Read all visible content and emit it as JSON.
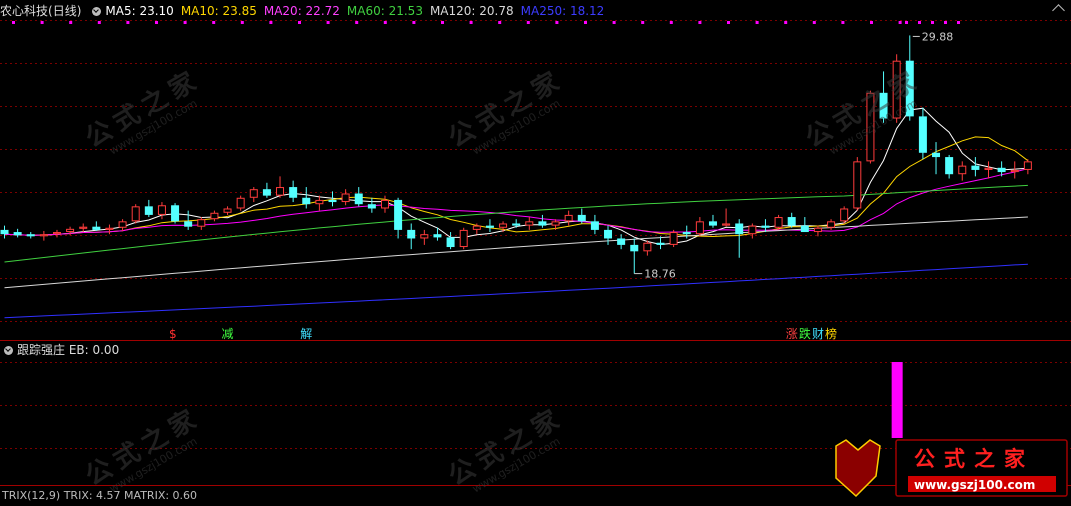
{
  "header": {
    "stock_name": "农心科技",
    "period": "(日线)",
    "ma": [
      {
        "label": "MA5: 23.10",
        "color": "#ffffff"
      },
      {
        "label": "MA10: 23.85",
        "color": "#ffd700"
      },
      {
        "label": "MA20: 22.72",
        "color": "#ff40ff"
      },
      {
        "label": "MA60: 21.53",
        "color": "#40d040"
      },
      {
        "label": "MA120: 20.78",
        "color": "#d8d8d8"
      },
      {
        "label": "MA250: 18.12",
        "color": "#3c3cff"
      }
    ]
  },
  "sub_panel": {
    "label": "跟踪强庄 EB: 0.00"
  },
  "bottom_panel": {
    "label": "TRIX(12,9)  TRIX: 4.57  MATRIX: 0.60"
  },
  "annotations": {
    "high": "29.88",
    "low": "18.76"
  },
  "signals": [
    {
      "text": "$",
      "color": "#ff3030",
      "candle": 13
    },
    {
      "text": "减",
      "color": "#40ff40",
      "candle": 17
    },
    {
      "text": "解",
      "color": "#40e0ff",
      "candle": 23
    },
    {
      "text": "涨",
      "color": "#ff4040",
      "candle": 60
    },
    {
      "text": "跌",
      "color": "#40ff40",
      "candle": 61
    },
    {
      "text": "财",
      "color": "#40e0ff",
      "candle": 62
    },
    {
      "text": "榜",
      "color": "#ffd700",
      "candle": 63
    }
  ],
  "watermarks": {
    "cn": "公式之家",
    "url": "www.gszj100.com"
  },
  "colors": {
    "up": "#ff3c3c",
    "down": "#54ffff",
    "grid": "#7a0000",
    "bg": "#000000",
    "magenta": "#ff00ff"
  },
  "chart_data": {
    "type": "candlestick",
    "ylim": [
      16.5,
      30.6
    ],
    "candles": [
      [
        20.8,
        21.0,
        20.4,
        20.6
      ],
      [
        20.7,
        20.85,
        20.45,
        20.55
      ],
      [
        20.6,
        20.7,
        20.4,
        20.5
      ],
      [
        20.5,
        20.75,
        20.3,
        20.6
      ],
      [
        20.6,
        20.8,
        20.45,
        20.7
      ],
      [
        20.7,
        20.95,
        20.55,
        20.85
      ],
      [
        20.85,
        21.1,
        20.7,
        20.95
      ],
      [
        20.95,
        21.2,
        20.75,
        20.8
      ],
      [
        20.8,
        21.05,
        20.6,
        20.9
      ],
      [
        20.9,
        21.3,
        20.75,
        21.2
      ],
      [
        21.2,
        22.0,
        21.1,
        21.9
      ],
      [
        21.9,
        22.2,
        21.4,
        21.5
      ],
      [
        21.5,
        22.1,
        21.3,
        21.95
      ],
      [
        21.95,
        22.05,
        21.1,
        21.2
      ],
      [
        21.2,
        21.7,
        20.8,
        20.95
      ],
      [
        20.95,
        21.4,
        20.8,
        21.3
      ],
      [
        21.3,
        21.7,
        21.2,
        21.6
      ],
      [
        21.6,
        21.9,
        21.5,
        21.8
      ],
      [
        21.8,
        22.4,
        21.7,
        22.3
      ],
      [
        22.3,
        22.8,
        22.1,
        22.7
      ],
      [
        22.7,
        23.0,
        22.3,
        22.4
      ],
      [
        22.4,
        23.3,
        22.3,
        22.8
      ],
      [
        22.8,
        23.1,
        22.1,
        22.3
      ],
      [
        22.3,
        22.8,
        21.8,
        22.0
      ],
      [
        22.0,
        22.4,
        21.7,
        22.2
      ],
      [
        22.2,
        22.6,
        21.9,
        22.1
      ],
      [
        22.1,
        22.7,
        21.95,
        22.5
      ],
      [
        22.5,
        22.8,
        21.9,
        22.0
      ],
      [
        22.0,
        22.3,
        21.6,
        21.8
      ],
      [
        21.8,
        22.4,
        21.6,
        22.2
      ],
      [
        22.2,
        22.3,
        20.4,
        20.8
      ],
      [
        20.8,
        21.1,
        19.9,
        20.4
      ],
      [
        20.4,
        20.8,
        20.1,
        20.6
      ],
      [
        20.6,
        20.9,
        20.3,
        20.45
      ],
      [
        20.45,
        20.7,
        19.9,
        20.0
      ],
      [
        20.0,
        20.9,
        19.9,
        20.8
      ],
      [
        20.8,
        21.1,
        20.6,
        21.0
      ],
      [
        21.0,
        21.3,
        20.7,
        20.9
      ],
      [
        20.9,
        21.2,
        20.7,
        21.1
      ],
      [
        21.1,
        21.3,
        20.9,
        21.0
      ],
      [
        21.0,
        21.4,
        20.8,
        21.2
      ],
      [
        21.2,
        21.5,
        20.9,
        21.0
      ],
      [
        21.0,
        21.3,
        20.8,
        21.2
      ],
      [
        21.2,
        21.7,
        21.0,
        21.5
      ],
      [
        21.5,
        21.8,
        21.1,
        21.2
      ],
      [
        21.2,
        21.5,
        20.6,
        20.8
      ],
      [
        20.8,
        21.0,
        20.1,
        20.4
      ],
      [
        20.4,
        20.6,
        19.9,
        20.1
      ],
      [
        20.1,
        20.4,
        18.76,
        19.8
      ],
      [
        19.8,
        20.3,
        19.6,
        20.2
      ],
      [
        20.2,
        20.5,
        19.9,
        20.1
      ],
      [
        20.1,
        20.8,
        20.0,
        20.7
      ],
      [
        20.7,
        21.0,
        20.4,
        20.6
      ],
      [
        20.6,
        21.4,
        20.5,
        21.2
      ],
      [
        21.2,
        21.5,
        20.9,
        21.0
      ],
      [
        21.0,
        21.8,
        20.95,
        21.1
      ],
      [
        21.1,
        21.3,
        19.5,
        20.6
      ],
      [
        20.6,
        21.1,
        20.4,
        21.0
      ],
      [
        21.0,
        21.3,
        20.7,
        20.9
      ],
      [
        20.9,
        21.5,
        20.8,
        21.4
      ],
      [
        21.4,
        21.6,
        20.9,
        21.0
      ],
      [
        21.0,
        21.4,
        20.8,
        20.7
      ],
      [
        20.7,
        21.0,
        20.5,
        20.9
      ],
      [
        20.9,
        21.3,
        20.8,
        21.2
      ],
      [
        21.2,
        21.9,
        21.1,
        21.8
      ],
      [
        21.8,
        24.2,
        21.7,
        24.0
      ],
      [
        24.0,
        27.3,
        23.9,
        27.2
      ],
      [
        27.2,
        28.2,
        25.8,
        26.0
      ],
      [
        26.0,
        29.0,
        25.8,
        28.7
      ],
      [
        28.7,
        29.88,
        25.9,
        26.1
      ],
      [
        26.1,
        26.5,
        24.1,
        24.4
      ],
      [
        24.4,
        24.9,
        23.4,
        24.2
      ],
      [
        24.2,
        24.3,
        23.2,
        23.4
      ],
      [
        23.4,
        24.0,
        23.1,
        23.8
      ],
      [
        23.8,
        24.2,
        23.3,
        23.6
      ],
      [
        23.6,
        24.0,
        23.2,
        23.7
      ],
      [
        23.7,
        24.0,
        23.3,
        23.5
      ],
      [
        23.5,
        24.0,
        23.2,
        23.6
      ],
      [
        23.6,
        24.1,
        23.4,
        24.0
      ]
    ],
    "eb_bars": [
      {
        "candle": 68,
        "value": 1.0
      }
    ]
  }
}
